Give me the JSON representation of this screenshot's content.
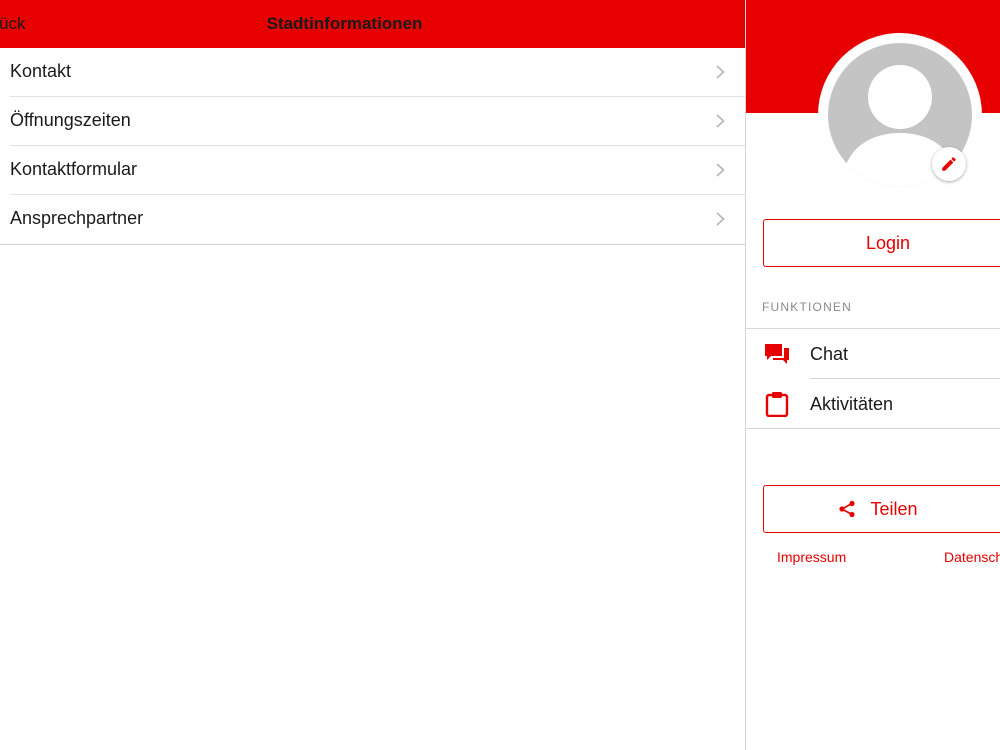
{
  "navbar": {
    "back_label": "ück",
    "title": "Stadtinformationen"
  },
  "list": {
    "items": [
      {
        "label": "Kontakt"
      },
      {
        "label": "Öffnungszeiten"
      },
      {
        "label": "Kontaktformular"
      },
      {
        "label": "Ansprechpartner"
      }
    ]
  },
  "profile": {
    "login_label": "Login",
    "section_label": "FUNKTIONEN",
    "functions": [
      {
        "label": "Chat",
        "icon": "chat-icon"
      },
      {
        "label": "Aktivitäten",
        "icon": "clipboard-icon"
      }
    ],
    "share_label": "Teilen",
    "footer": {
      "impressum": "Impressum",
      "datenschutz": "Datensch"
    }
  },
  "colors": {
    "accent": "#e60000",
    "avatar_placeholder": "#c4c4c4",
    "text": "#1a1a1a",
    "muted": "#8a8a8a",
    "chevron": "#b5b5b5"
  }
}
